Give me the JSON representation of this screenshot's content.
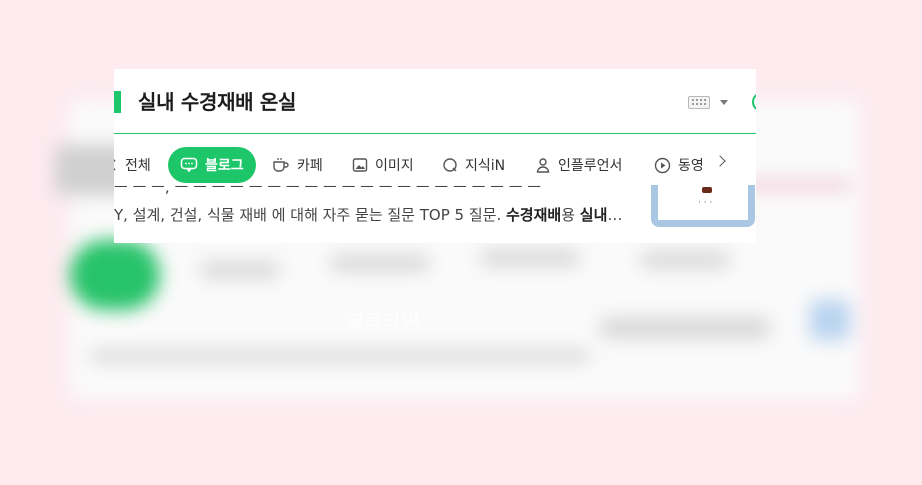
{
  "search": {
    "query": "실내 수경재배 온실"
  },
  "tabs": [
    {
      "label": "전체",
      "icon": "search-icon"
    },
    {
      "label": "블로그",
      "icon": "blog-icon",
      "active": true
    },
    {
      "label": "카페",
      "icon": "cafe-cup-icon"
    },
    {
      "label": "이미지",
      "icon": "image-icon"
    },
    {
      "label": "지식iN",
      "icon": "question-bubble-icon"
    },
    {
      "label": "인플루언서",
      "icon": "person-icon"
    },
    {
      "label": "동영",
      "icon": "play-icon"
    }
  ],
  "result": {
    "snippet_prefix": "Y, 설계, 건설, 식물 재배 에 대해 자주 묻는 질문 TOP 5 질문. ",
    "snippet_bold_1": "수경재배",
    "snippet_mid": "용 ",
    "snippet_bold_2": "실내",
    "snippet_ellipsis": "…",
    "thumbnail_dots": "· · ·"
  },
  "background_text": "글루타민",
  "colors": {
    "accent": "#1ec66a",
    "background": "#fdebf0"
  }
}
